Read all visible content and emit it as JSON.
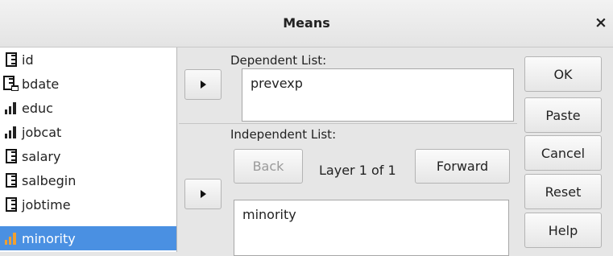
{
  "dialog": {
    "title": "Means",
    "close_glyph": "×"
  },
  "variables": [
    {
      "name": "id",
      "icon": "scale-ruler-icon",
      "selected": false
    },
    {
      "name": "bdate",
      "icon": "date-scale-icon",
      "selected": false
    },
    {
      "name": "educ",
      "icon": "ordinal-bars-icon",
      "selected": false
    },
    {
      "name": "jobcat",
      "icon": "ordinal-bars-icon",
      "selected": false
    },
    {
      "name": "salary",
      "icon": "scale-ruler-icon",
      "selected": false
    },
    {
      "name": "salbegin",
      "icon": "scale-ruler-icon",
      "selected": false
    },
    {
      "name": "jobtime",
      "icon": "scale-ruler-icon",
      "selected": false
    },
    {
      "name": "minority",
      "icon": "ordinal-bars-icon",
      "selected": true
    }
  ],
  "dependent": {
    "label": "Dependent List:",
    "items": [
      "prevexp"
    ]
  },
  "independent": {
    "label": "Independent List:",
    "back_label": "Back",
    "layer_text": "Layer 1 of 1",
    "forward_label": "Forward",
    "items": [
      "minority"
    ]
  },
  "buttons": {
    "ok": "OK",
    "paste": "Paste",
    "cancel": "Cancel",
    "reset": "Reset",
    "help": "Help"
  },
  "colors": {
    "selection": "#4a90e2",
    "window_bg": "#e6e6e6"
  }
}
